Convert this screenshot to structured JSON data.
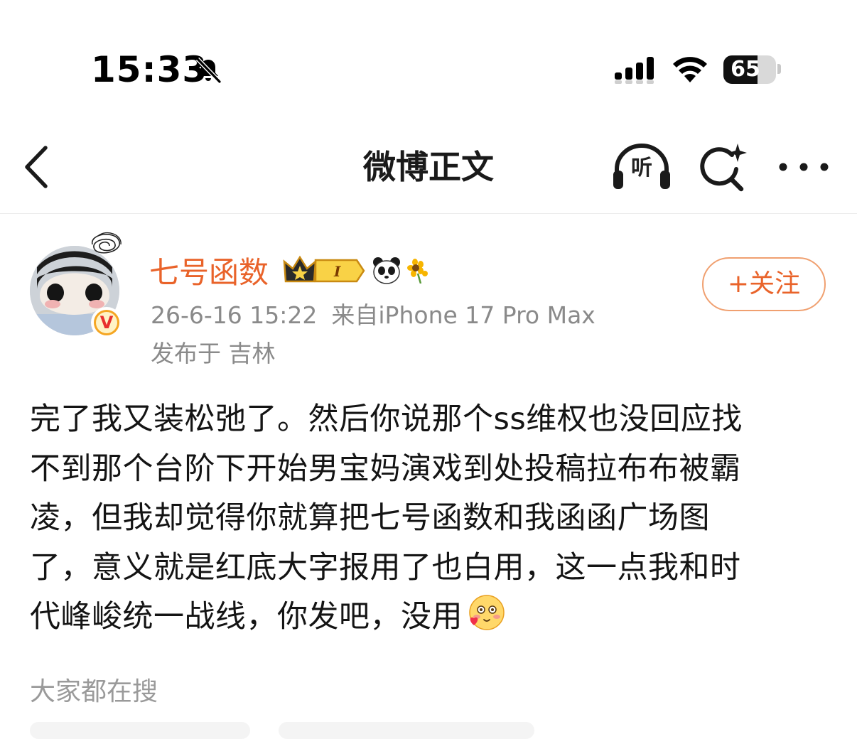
{
  "status_bar": {
    "time": "15:33",
    "battery_level": "65",
    "battery_fraction": 0.65,
    "icons": [
      "bell-slash-icon",
      "cellular-signal-icon",
      "wifi-icon",
      "battery-icon"
    ]
  },
  "nav": {
    "title": "微博正文",
    "listen_label": "听",
    "icons": [
      "chevron-left-icon",
      "headphones-icon",
      "search-sparkle-icon",
      "more-dots-icon"
    ]
  },
  "post": {
    "author": {
      "name": "七号函数",
      "badges": [
        "crown-level-badge",
        "panda-icon",
        "sunflower-icon"
      ],
      "level_mark": "I",
      "verified_mark": "V"
    },
    "meta": {
      "date": "26-6-16 15:22",
      "source": "来自iPhone 17 Pro Max",
      "location": "发布于 吉林"
    },
    "follow_label": "+关注",
    "lines": [
      "完了我又装松弛了。然后你说那个ss维权也没回应找",
      "不到那个台阶下开始男宝妈演戏到处投稿拉布布被霸",
      "凌，但我却觉得你就算把七号函数和我函函广场图",
      "了，意义就是红底大字报用了也白用，这一点我和时",
      "代峰峻统一战线，你发吧，没用"
    ],
    "trailing_emoji": "heart-face-emoji"
  },
  "trending": {
    "label": "大家都在搜"
  },
  "colors": {
    "accent": "#e9632a",
    "meta_gray": "#8a8a8a",
    "follow_border": "#f0a070"
  }
}
